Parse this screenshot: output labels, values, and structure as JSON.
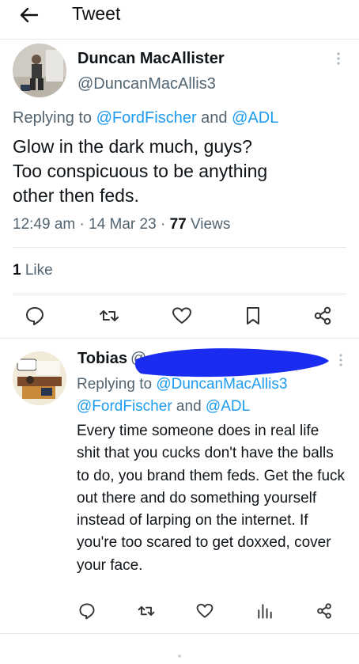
{
  "header": {
    "title": "Tweet"
  },
  "main_tweet": {
    "display_name": "Duncan MacAllister",
    "handle": "@DuncanMacAllis3",
    "replying_prefix": "Replying to ",
    "reply_to_1": "@FordFischer",
    "reply_and": " and ",
    "reply_to_2": "@ADL",
    "text_line_1": "Glow in the dark much, guys?",
    "text_line_2": "Too conspicuous to be anything",
    "text_line_3": "other then feds.",
    "time": "12:49 am",
    "date": "14 Mar 23",
    "sep": " · ",
    "views_count": "77",
    "views_label": " Views",
    "likes_count": "1",
    "likes_label": " Like"
  },
  "reply_tweet": {
    "display_name": "Tobias",
    "handle_visible": "@",
    "replying_prefix": "Replying to ",
    "reply_to_1": "@DuncanMacAllis3",
    "reply_to_2": "@FordFischer",
    "reply_and": " and ",
    "reply_to_3": "@ADL",
    "text": "Every time someone does in real life shit that you cucks don't have the balls to do, you brand them feds. Get the fuck out there and do something yourself instead of larping on the internet. If you're too scared to get doxxed, cover your face."
  },
  "colors": {
    "link": "#1d9bf0",
    "secondary": "#536471",
    "primary": "#0f1419",
    "redaction": "#1a2cf0"
  },
  "icons": [
    "back-arrow-icon",
    "more-vertical-icon",
    "reply-icon",
    "retweet-icon",
    "like-icon",
    "bookmark-icon",
    "share-icon",
    "analytics-icon"
  ]
}
